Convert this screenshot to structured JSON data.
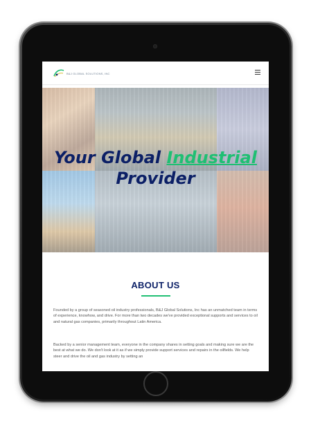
{
  "site": {
    "logo_text": "B&J GLOBAL SOLUTIONS, INC",
    "menu_icon": "hamburger-menu-icon"
  },
  "hero": {
    "title_part1": "Your Global ",
    "title_highlight": "Industrial",
    "title_part2": "Provider"
  },
  "about": {
    "heading": "ABOUT US",
    "paragraph1": "Founded by a group of seasoned oil industry professionals, B&J Global Solutions, Inc has an unmatched team in terms of experience, knowhow, and drive. For more than two decades we've provided exceptional supports and services to oil and natural gas companies, primarily throughout Latin America.",
    "paragraph2": "Backed by a senior management team, everyone in the company shares in setting goals and making sure we are the best at what we do. We don't look at it as if we simply provide support services and repairs in the oilfields. We help steer and drive the oil and gas industry by setting an"
  },
  "colors": {
    "brand_navy": "#0b1f66",
    "brand_green": "#1fbf73",
    "device_frame": "#1a1a1a"
  }
}
